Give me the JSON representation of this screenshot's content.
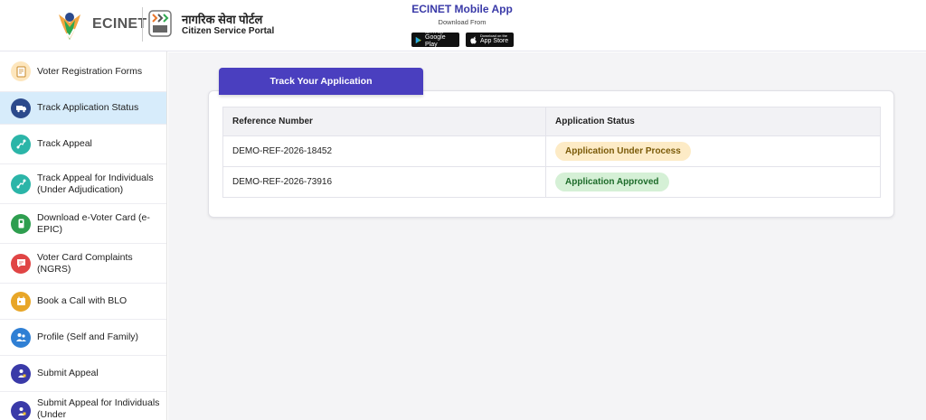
{
  "header": {
    "eci_text": "ECINET",
    "portal_hindi": "नागरिक सेवा पोर्टल",
    "portal_english": "Citizen Service Portal",
    "app_title": "ECINET Mobile App",
    "app_subtitle": "Download From",
    "google_play_small": "GET IT ON",
    "google_play_label": "Google Play",
    "app_store_small": "Download on the",
    "app_store_label": "App Store"
  },
  "sidebar": {
    "items": [
      {
        "label": "Voter Registration Forms",
        "icon": "form-icon",
        "color": "#f4a62a"
      },
      {
        "label": "Track Application Status",
        "icon": "truck-icon",
        "color": "#2c4a8c"
      },
      {
        "label": "Track Appeal",
        "icon": "route-icon",
        "color": "#2bb5a8"
      },
      {
        "label": "Track Appeal for Individuals (Under Adjudication)",
        "icon": "route-icon",
        "color": "#2bb5a8"
      },
      {
        "label": "Download e-Voter Card (e-EPIC)",
        "icon": "card-icon",
        "color": "#2e9e4f"
      },
      {
        "label": "Voter Card Complaints (NGRS)",
        "icon": "complaint-icon",
        "color": "#e04545"
      },
      {
        "label": "Book a Call with BLO",
        "icon": "calendar-icon",
        "color": "#e8a628"
      },
      {
        "label": "Profile (Self and Family)",
        "icon": "family-icon",
        "color": "#2f7fd4"
      },
      {
        "label": "Submit Appeal",
        "icon": "appeal-icon",
        "color": "#3a3aa8"
      },
      {
        "label": "Submit Appeal for Individuals (Under",
        "icon": "appeal-icon",
        "color": "#3a3aa8"
      }
    ]
  },
  "main": {
    "tab_label": "Track Your Application",
    "table": {
      "headers": [
        "Reference Number",
        "Application Status"
      ],
      "rows": [
        {
          "reference": "DEMO-REF-2026-18452",
          "status": "Application Under Process"
        },
        {
          "reference": "DEMO-REF-2026-73916",
          "status": "Application Approved"
        }
      ]
    }
  },
  "colors": {
    "accent": "#4a3fbf",
    "active_sidebar": "#d7ecfb",
    "status_process_bg": "#fdebc6",
    "status_approved_bg": "#d5f0d6"
  }
}
